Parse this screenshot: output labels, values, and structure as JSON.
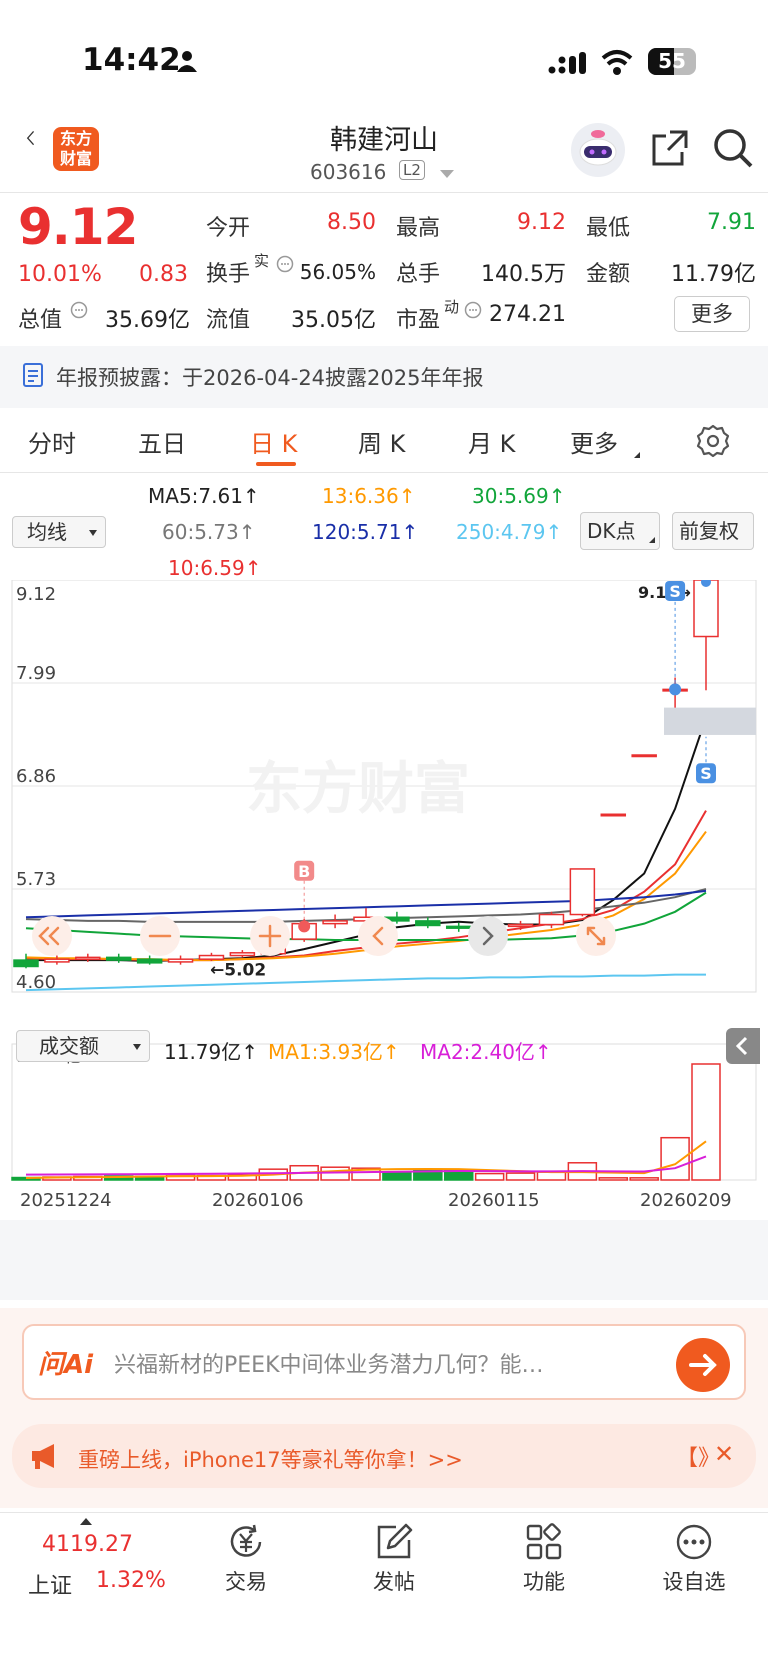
{
  "status_bar": {
    "time": "14:42",
    "battery": "55"
  },
  "header": {
    "logo_text_1": "东方",
    "logo_text_2": "财富",
    "stock_name": "韩建河山",
    "stock_code": "603616",
    "level_badge": "L2"
  },
  "quote": {
    "price": "9.12",
    "change_pct": "10.01%",
    "change": "0.83",
    "open_label": "今开",
    "open": "8.50",
    "high_label": "最高",
    "high": "9.12",
    "low_label": "最低",
    "low": "7.91",
    "turnover_label": "换手",
    "turnover_sup": "实",
    "turnover": "56.05%",
    "volume_label": "总手",
    "volume": "140.5万",
    "amount_label": "金额",
    "amount": "11.79亿",
    "mktcap_label": "总值",
    "mktcap": "35.69亿",
    "float_label": "流值",
    "float": "35.05亿",
    "pe_label": "市盈",
    "pe_sup": "动",
    "pe": "274.21",
    "more_label": "更多"
  },
  "notice": {
    "text": "年报预披露：于2026-04-24披露2025年年报"
  },
  "tabs": [
    "分时",
    "五日",
    "日 K",
    "周 K",
    "月 K",
    "更多"
  ],
  "active_tab": "日 K",
  "ma_panel": {
    "dropdown": "均线",
    "ma5": "MA5:7.61↑",
    "ma13": "13:6.36↑",
    "ma30": "30:5.69↑",
    "ma60": "60:5.73↑",
    "ma120": "120:5.71↑",
    "ma250": "250:4.79↑",
    "ma10": "10:6.59↑",
    "dk_button": "DK点",
    "adjust_button": "前复权"
  },
  "chart_data": {
    "type": "candlestick",
    "y_ticks": [
      "9.12",
      "7.99",
      "6.86",
      "5.73",
      "4.60"
    ],
    "ylim": [
      4.6,
      9.12
    ],
    "max_label": "9.12",
    "min_label": "←5.02",
    "signal_labels": [
      "B",
      "S",
      "S"
    ],
    "watermark": "东方财富",
    "candles": [
      {
        "o": 4.95,
        "c": 4.88,
        "h": 5.02,
        "l": 4.86
      },
      {
        "o": 4.93,
        "c": 4.96,
        "h": 5.0,
        "l": 4.9
      },
      {
        "o": 4.96,
        "c": 4.98,
        "h": 5.02,
        "l": 4.93
      },
      {
        "o": 4.98,
        "c": 4.95,
        "h": 5.02,
        "l": 4.92
      },
      {
        "o": 4.96,
        "c": 4.92,
        "h": 5.0,
        "l": 4.9
      },
      {
        "o": 4.93,
        "c": 4.96,
        "h": 5.0,
        "l": 4.9
      },
      {
        "o": 4.96,
        "c": 5.0,
        "h": 5.03,
        "l": 4.94
      },
      {
        "o": 5.0,
        "c": 5.03,
        "h": 5.06,
        "l": 4.98
      },
      {
        "o": 5.02,
        "c": 5.18,
        "h": 5.22,
        "l": 5.0
      },
      {
        "o": 5.18,
        "c": 5.35,
        "h": 5.4,
        "l": 5.15
      },
      {
        "o": 5.35,
        "c": 5.38,
        "h": 5.45,
        "l": 5.3
      },
      {
        "o": 5.38,
        "c": 5.42,
        "h": 5.52,
        "l": 5.33
      },
      {
        "o": 5.42,
        "c": 5.38,
        "h": 5.48,
        "l": 5.35
      },
      {
        "o": 5.38,
        "c": 5.33,
        "h": 5.42,
        "l": 5.3
      },
      {
        "o": 5.32,
        "c": 5.3,
        "h": 5.36,
        "l": 5.26
      },
      {
        "o": 5.3,
        "c": 5.32,
        "h": 5.36,
        "l": 5.27
      },
      {
        "o": 5.32,
        "c": 5.34,
        "h": 5.38,
        "l": 5.28
      },
      {
        "o": 5.34,
        "c": 5.45,
        "h": 5.48,
        "l": 5.3
      },
      {
        "o": 5.45,
        "c": 5.95,
        "h": 5.95,
        "l": 5.43
      },
      {
        "o": 6.55,
        "c": 6.55,
        "h": 6.55,
        "l": 6.55
      },
      {
        "o": 7.2,
        "c": 7.2,
        "h": 7.2,
        "l": 7.2
      },
      {
        "o": 7.92,
        "c": 7.92,
        "h": 8.05,
        "l": 7.7
      },
      {
        "o": 8.5,
        "c": 9.12,
        "h": 9.12,
        "l": 7.91
      }
    ],
    "ma_series": [
      {
        "name": "MA5",
        "color": "#111111",
        "values": [
          4.95,
          4.95,
          4.95,
          4.95,
          4.94,
          4.95,
          4.96,
          4.97,
          5.0,
          5.07,
          5.15,
          5.23,
          5.31,
          5.35,
          5.37,
          5.35,
          5.34,
          5.34,
          5.39,
          5.61,
          5.9,
          6.61,
          7.61
        ]
      },
      {
        "name": "MA10",
        "color": "#e93030",
        "values": [
          4.97,
          4.96,
          4.96,
          4.96,
          4.95,
          4.95,
          4.95,
          4.96,
          4.98,
          5.0,
          5.05,
          5.09,
          5.13,
          5.16,
          5.2,
          5.25,
          5.3,
          5.35,
          5.4,
          5.5,
          5.7,
          6.0,
          6.59
        ]
      },
      {
        "name": "MA13",
        "color": "#ff9900",
        "values": [
          4.98,
          4.97,
          4.97,
          4.96,
          4.96,
          4.95,
          4.95,
          4.96,
          4.97,
          4.99,
          5.02,
          5.06,
          5.1,
          5.13,
          5.16,
          5.2,
          5.24,
          5.28,
          5.34,
          5.44,
          5.62,
          5.9,
          6.36
        ]
      },
      {
        "name": "MA30",
        "color": "#11a53a",
        "values": [
          5.3,
          5.28,
          5.26,
          5.24,
          5.22,
          5.21,
          5.2,
          5.19,
          5.18,
          5.18,
          5.17,
          5.17,
          5.17,
          5.17,
          5.17,
          5.17,
          5.18,
          5.19,
          5.22,
          5.27,
          5.35,
          5.48,
          5.69
        ]
      },
      {
        "name": "MA60",
        "color": "#666666",
        "values": [
          5.4,
          5.39,
          5.38,
          5.38,
          5.37,
          5.37,
          5.37,
          5.37,
          5.37,
          5.38,
          5.39,
          5.4,
          5.41,
          5.42,
          5.43,
          5.44,
          5.45,
          5.47,
          5.5,
          5.54,
          5.58,
          5.64,
          5.73
        ]
      },
      {
        "name": "MA120",
        "color": "#1a2fa8",
        "values": [
          5.42,
          5.43,
          5.44,
          5.45,
          5.46,
          5.47,
          5.48,
          5.49,
          5.5,
          5.51,
          5.52,
          5.53,
          5.54,
          5.55,
          5.56,
          5.57,
          5.58,
          5.59,
          5.6,
          5.62,
          5.64,
          5.67,
          5.71
        ]
      },
      {
        "name": "MA250",
        "color": "#5cc6f0",
        "values": [
          4.62,
          4.63,
          4.64,
          4.65,
          4.66,
          4.67,
          4.68,
          4.69,
          4.7,
          4.71,
          4.72,
          4.73,
          4.74,
          4.75,
          4.75,
          4.76,
          4.76,
          4.77,
          4.77,
          4.78,
          4.78,
          4.79,
          4.79
        ]
      }
    ],
    "volume": {
      "max_label": "11.79亿",
      "ylim": [
        0,
        11.79
      ],
      "values": [
        0.25,
        0.3,
        0.35,
        0.4,
        0.35,
        0.55,
        0.45,
        0.5,
        1.1,
        1.45,
        1.3,
        1.2,
        0.8,
        1.1,
        1.0,
        0.65,
        0.7,
        0.8,
        1.75,
        0.22,
        0.22,
        4.3,
        11.79
      ],
      "ma1": [
        0.2,
        0.25,
        0.28,
        0.31,
        0.35,
        0.38,
        0.4,
        0.43,
        0.55,
        0.75,
        0.9,
        1.05,
        1.1,
        1.12,
        1.1,
        1.0,
        0.9,
        0.8,
        0.8,
        0.75,
        0.7,
        1.6,
        3.93
      ],
      "ma2": [
        0.55,
        0.56,
        0.57,
        0.58,
        0.6,
        0.62,
        0.64,
        0.66,
        0.68,
        0.72,
        0.76,
        0.8,
        0.84,
        0.88,
        0.92,
        0.9,
        0.88,
        0.88,
        0.9,
        0.88,
        0.86,
        1.2,
        2.4
      ],
      "ma1_color": "#ff9900",
      "ma2_color": "#d81fd8"
    },
    "x_ticks": [
      "20251224",
      "20260106",
      "20260115",
      "20260209"
    ]
  },
  "volume_panel": {
    "dropdown": "成交额",
    "value": "11.79亿↑",
    "ma1": "MA1:3.93亿↑",
    "ma2": "MA2:2.40亿↑"
  },
  "ai_bar": {
    "logo": "问Ai",
    "placeholder": "兴福新材的PEEK中间体业务潜力几何？能…"
  },
  "promo": {
    "text": "重磅上线，iPhone17等豪礼等你拿！>>",
    "mark": "【》",
    "close": "✕"
  },
  "bottom_nav": {
    "index_value": "4119.27",
    "index_name": "上证",
    "index_pct": "1.32%",
    "items": [
      "交易",
      "发帖",
      "功能",
      "设自选"
    ]
  }
}
